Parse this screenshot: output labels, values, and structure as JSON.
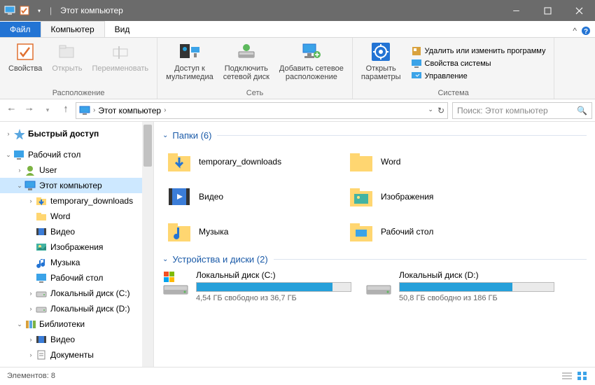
{
  "titlebar": {
    "title": "Этот компьютер"
  },
  "tabs": {
    "file": "Файл",
    "computer": "Компьютер",
    "view": "Вид"
  },
  "ribbon": {
    "location_group": "Расположение",
    "properties": "Свойства",
    "open": "Открыть",
    "rename": "Переименовать",
    "network_group": "Сеть",
    "media_access": "Доступ к\nмультимедиа",
    "map_net": "Подключить\nсетевой диск",
    "add_netloc": "Добавить сетевое\nрасположение",
    "system_group": "Система",
    "open_settings": "Открыть\nпараметры",
    "uninstall": "Удалить или изменить программу",
    "sys_props": "Свойства системы",
    "manage": "Управление"
  },
  "breadcrumb": [
    "Этот компьютер"
  ],
  "search_placeholder": "Поиск: Этот компьютер",
  "tree": [
    {
      "depth": 0,
      "exp": ">",
      "icon": "star",
      "label": "Быстрый доступ",
      "sel": false,
      "bold": true
    },
    {
      "depth": 0,
      "exp": "v",
      "icon": "desktop",
      "label": "Рабочий стол",
      "sel": false
    },
    {
      "depth": 1,
      "exp": ">",
      "icon": "user",
      "label": "User",
      "sel": false
    },
    {
      "depth": 1,
      "exp": "v",
      "icon": "pc",
      "label": "Этот компьютер",
      "sel": true
    },
    {
      "depth": 2,
      "exp": ">",
      "icon": "dlfolder",
      "label": "temporary_downloads",
      "sel": false
    },
    {
      "depth": 2,
      "exp": "",
      "icon": "folder",
      "label": "Word",
      "sel": false
    },
    {
      "depth": 2,
      "exp": "",
      "icon": "video",
      "label": "Видео",
      "sel": false
    },
    {
      "depth": 2,
      "exp": "",
      "icon": "picture",
      "label": "Изображения",
      "sel": false
    },
    {
      "depth": 2,
      "exp": "",
      "icon": "music",
      "label": "Музыка",
      "sel": false
    },
    {
      "depth": 2,
      "exp": "",
      "icon": "desktop",
      "label": "Рабочий стол",
      "sel": false
    },
    {
      "depth": 2,
      "exp": ">",
      "icon": "drive",
      "label": "Локальный диск (C:)",
      "sel": false
    },
    {
      "depth": 2,
      "exp": ">",
      "icon": "drive",
      "label": "Локальный диск (D:)",
      "sel": false
    },
    {
      "depth": 1,
      "exp": "v",
      "icon": "library",
      "label": "Библиотеки",
      "sel": false
    },
    {
      "depth": 2,
      "exp": ">",
      "icon": "video",
      "label": "Видео",
      "sel": false
    },
    {
      "depth": 2,
      "exp": ">",
      "icon": "doc",
      "label": "Документы",
      "sel": false
    }
  ],
  "groups": {
    "folders_header": "Папки (6)",
    "drives_header": "Устройства и диски (2)"
  },
  "folders": [
    {
      "icon": "dlfolder",
      "name": "temporary_downloads"
    },
    {
      "icon": "folder",
      "name": "Word"
    },
    {
      "icon": "video",
      "name": "Видео"
    },
    {
      "icon": "picture",
      "name": "Изображения"
    },
    {
      "icon": "music",
      "name": "Музыка"
    },
    {
      "icon": "desktop-folder",
      "name": "Рабочий стол"
    }
  ],
  "drives": [
    {
      "name": "Локальный диск (C:)",
      "free_text": "4,54 ГБ свободно из 36,7 ГБ",
      "fill_pct": 88,
      "win": true
    },
    {
      "name": "Локальный диск (D:)",
      "free_text": "50,8 ГБ свободно из 186 ГБ",
      "fill_pct": 73,
      "win": false
    }
  ],
  "status": {
    "items": "Элементов: 8"
  }
}
